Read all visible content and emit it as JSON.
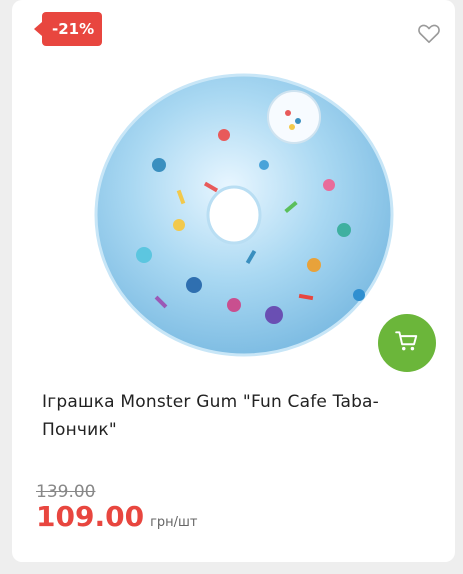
{
  "badge": {
    "discount": "-21%"
  },
  "product": {
    "title": "Іграшка Monster Gum \"Fun Cafe Taba- Пончик\"",
    "old_price": "139.00",
    "price": "109.00",
    "unit": "грн/шт"
  },
  "colors": {
    "accent_red": "#e8463f",
    "cart_green": "#6bb63a"
  },
  "icons": {
    "favorite": "heart-outline-icon",
    "cart": "shopping-cart-icon"
  }
}
